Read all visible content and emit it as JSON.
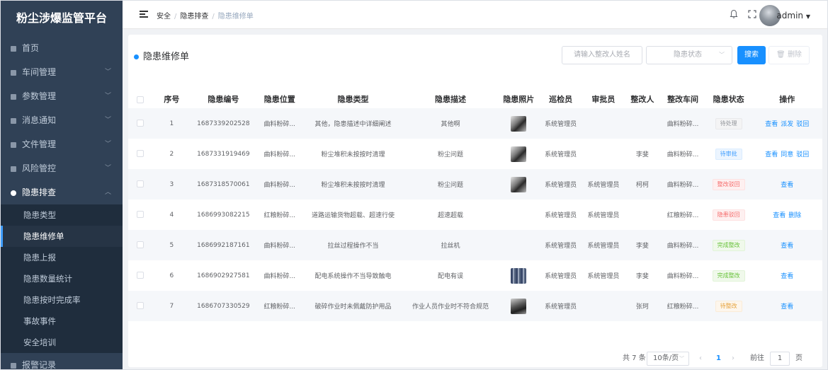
{
  "app": {
    "title": "粉尘涉爆监管平台"
  },
  "sidebar": {
    "items": [
      {
        "label": "首页",
        "has_children": false
      },
      {
        "label": "车间管理",
        "has_children": true
      },
      {
        "label": "参数管理",
        "has_children": true
      },
      {
        "label": "消息通知",
        "has_children": true
      },
      {
        "label": "文件管理",
        "has_children": true
      },
      {
        "label": "风险管控",
        "has_children": true
      },
      {
        "label": "隐患排查",
        "has_children": true,
        "expanded": true
      }
    ],
    "sub_items": [
      {
        "label": "隐患类型"
      },
      {
        "label": "隐患维修单",
        "active": true
      },
      {
        "label": "隐患上报"
      },
      {
        "label": "隐患数量统计"
      },
      {
        "label": "隐患按时完成率"
      },
      {
        "label": "事故事件"
      },
      {
        "label": "安全培训"
      }
    ],
    "after_items": [
      {
        "label": "报警记录"
      }
    ]
  },
  "header": {
    "breadcrumb": [
      "安全",
      "隐患排查",
      "隐患维修单"
    ],
    "username": "admin"
  },
  "card": {
    "title": "隐患维修单",
    "search_placeholder": "请输入整改人姓名",
    "status_placeholder": "隐患状态",
    "search_button": "搜索",
    "delete_button": "删除"
  },
  "table": {
    "columns": [
      "序号",
      "隐患编号",
      "隐患位置",
      "隐患类型",
      "隐患描述",
      "隐患照片",
      "巡检员",
      "审批员",
      "整改人",
      "整改车间",
      "隐患状态",
      "操作"
    ],
    "rows": [
      {
        "no": "1",
        "code": "1687339202528",
        "location": "曲料粉碎...",
        "type": "其他，隐患描述中详细阐述",
        "desc": "其他啊",
        "photo": "p1",
        "inspector": "系统管理员",
        "approver": "",
        "rectifier": "",
        "workshop": "曲料粉碎...",
        "status": "待处理",
        "status_color": "gray",
        "ops": [
          "查看",
          "派发",
          "驳回"
        ]
      },
      {
        "no": "2",
        "code": "1687331919469",
        "location": "曲料粉碎...",
        "type": "粉尘堆积未按按时清理",
        "desc": "粉尘问题",
        "photo": "p1",
        "inspector": "系统管理员",
        "approver": "",
        "rectifier": "李斐",
        "workshop": "曲料粉碎...",
        "status": "待审批",
        "status_color": "blue",
        "ops": [
          "查看",
          "同意",
          "驳回"
        ]
      },
      {
        "no": "3",
        "code": "1687318570061",
        "location": "曲料粉碎...",
        "type": "粉尘堆积未按按时清理",
        "desc": "粉尘问题",
        "photo": "p1",
        "inspector": "系统管理员",
        "approver": "系统管理员",
        "rectifier": "柯柯",
        "workshop": "曲料粉碎...",
        "status": "整改驳回",
        "status_color": "red",
        "ops": [
          "查看"
        ]
      },
      {
        "no": "4",
        "code": "1686993082215",
        "location": "红粮粉碎...",
        "type": "道路运输货物超载、超速行使",
        "desc": "超速超载",
        "photo": "",
        "inspector": "系统管理员",
        "approver": "系统管理员",
        "rectifier": "",
        "workshop": "红粮粉碎...",
        "status": "隐患驳回",
        "status_color": "red",
        "ops": [
          "查看",
          "删除"
        ]
      },
      {
        "no": "5",
        "code": "1686992187161",
        "location": "曲料粉碎...",
        "type": "拉丝过程操作不当",
        "desc": "拉丝机",
        "photo": "",
        "inspector": "系统管理员",
        "approver": "系统管理员",
        "rectifier": "李斐",
        "workshop": "曲料粉碎...",
        "status": "完成整改",
        "status_color": "green",
        "ops": [
          "查看"
        ]
      },
      {
        "no": "6",
        "code": "1686902927581",
        "location": "曲料粉碎...",
        "type": "配电系统操作不当导致触电",
        "desc": "配电有误",
        "photo": "p2",
        "inspector": "系统管理员",
        "approver": "系统管理员",
        "rectifier": "李斐",
        "workshop": "曲料粉碎...",
        "status": "完成整改",
        "status_color": "green",
        "ops": [
          "查看"
        ]
      },
      {
        "no": "7",
        "code": "1686707330529",
        "location": "红粮粉碎...",
        "type": "破碎作业时未佩戴防护用品",
        "desc": "作业人员作业时不符合规范",
        "photo": "p3",
        "inspector": "系统管理员",
        "approver": "",
        "rectifier": "张珂",
        "workshop": "红粮粉碎...",
        "status": "待整改",
        "status_color": "orange",
        "ops": [
          "查看"
        ]
      }
    ]
  },
  "pagination": {
    "total": "共 7 条",
    "page_size": "10条/页",
    "current": "1",
    "goto_label": "前往",
    "goto_value": "1",
    "page_suffix": "页"
  },
  "colors": {
    "sidebar_bg": "#304156",
    "accent": "#1890ff"
  }
}
